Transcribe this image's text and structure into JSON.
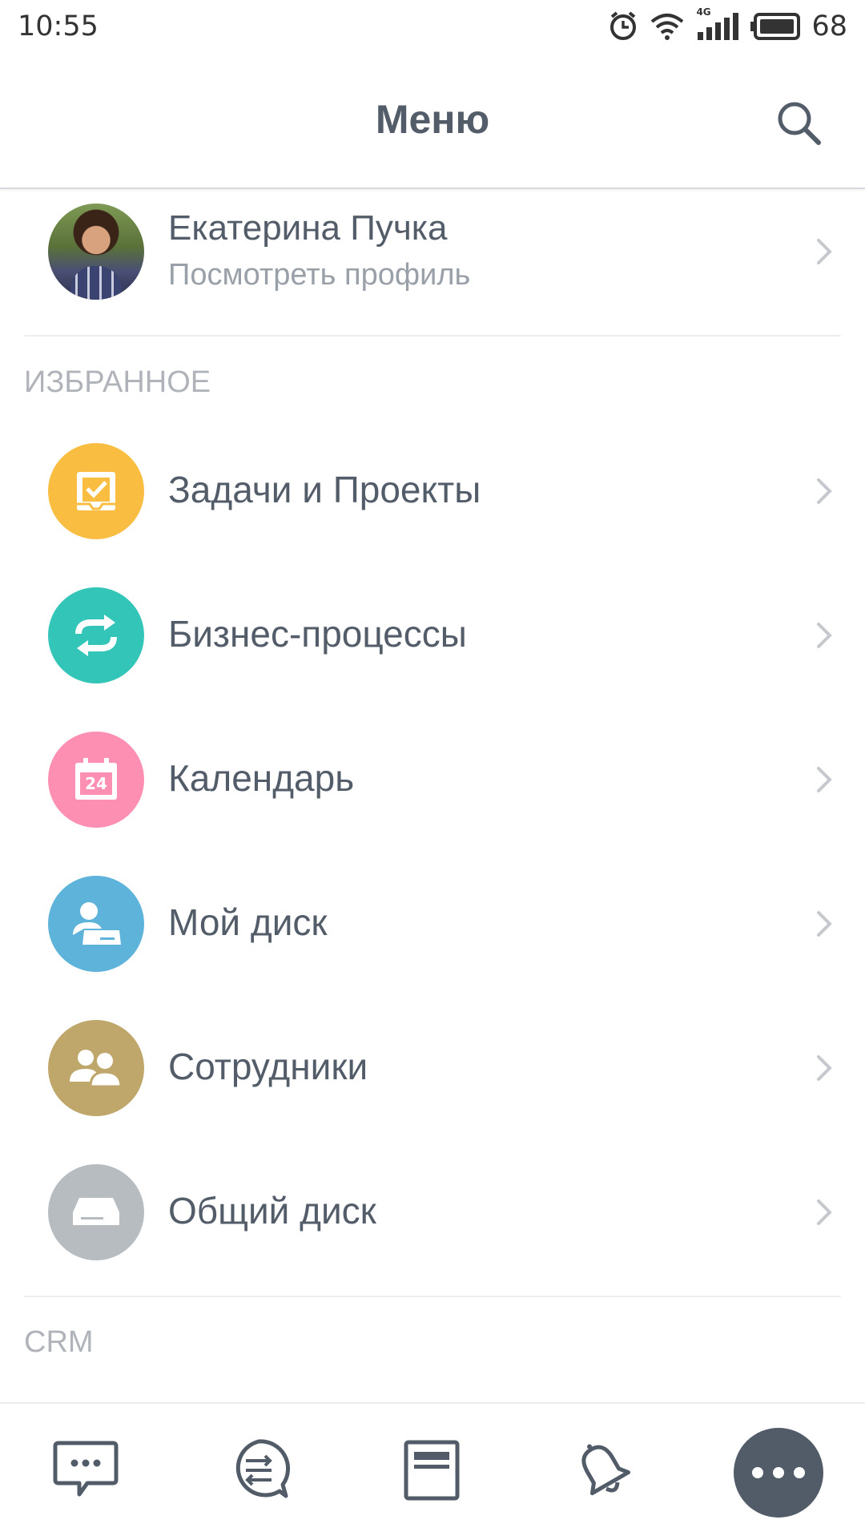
{
  "status_bar": {
    "time": "10:55",
    "network": "4G",
    "battery": "68"
  },
  "header": {
    "title": "Меню",
    "search_icon": "search-icon"
  },
  "profile": {
    "name": "Екатерина Пучка",
    "subtitle": "Посмотреть профиль"
  },
  "sections": {
    "favorites": "ИЗБРАННОЕ",
    "crm": "CRM"
  },
  "menu_items": [
    {
      "label": "Задачи и Проекты",
      "icon": "tasks-icon",
      "color": "#f9bd41"
    },
    {
      "label": "Бизнес-процессы",
      "icon": "business-process-icon",
      "color": "#33c5b8"
    },
    {
      "label": "Календарь",
      "icon": "calendar-icon",
      "color": "#fd8fb2",
      "icon_text": "24"
    },
    {
      "label": "Мой диск",
      "icon": "my-drive-icon",
      "color": "#5db3da"
    },
    {
      "label": "Сотрудники",
      "icon": "employees-icon",
      "color": "#bfa66a"
    },
    {
      "label": "Общий диск",
      "icon": "shared-drive-icon",
      "color": "#b7bcc1"
    }
  ],
  "tabbar": {
    "items": [
      "chat-icon",
      "feed-icon",
      "tasks-list-icon",
      "notifications-icon",
      "more-icon"
    ],
    "active_color": "#525c68"
  }
}
